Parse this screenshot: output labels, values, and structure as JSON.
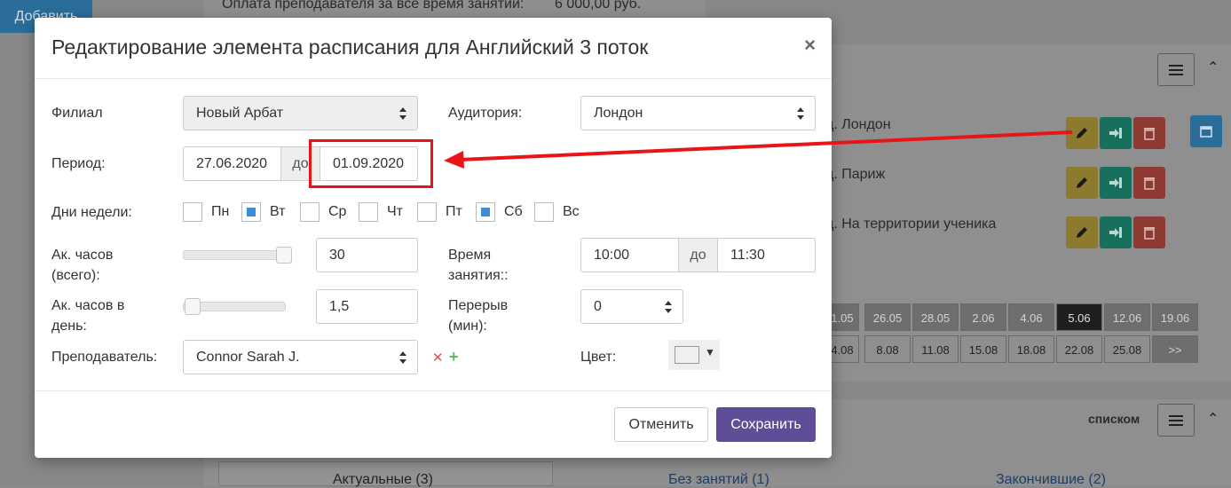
{
  "background": {
    "top_text_label": "Оплата преподавателя за всё время занятий:",
    "top_text_value": "6 000,00 руб.",
    "add_button": "Добавить",
    "rooms": [
      "д. Лондон",
      "д. Париж",
      "д. На территории ученика"
    ],
    "calendar_top": [
      "1.05",
      "26.05",
      "28.05",
      "2.06",
      "4.06",
      "5.06",
      "12.06",
      "19.06"
    ],
    "calendar_bottom": [
      "4.08",
      "8.08",
      "11.08",
      "15.08",
      "18.08",
      "22.08",
      "25.08",
      ">>"
    ],
    "list_label": "списком",
    "tabs": [
      "Актуальные (3)",
      "Без занятий (1)",
      "Закончившие (2)"
    ]
  },
  "modal": {
    "title": "Редактирование элемента расписания для Английский 3 поток",
    "close": "×",
    "branch_label": "Филиал",
    "branch_value": "Новый Арбат",
    "room_label": "Аудитория:",
    "room_value": "Лондон",
    "period_label": "Период:",
    "period_from": "27.06.2020",
    "period_sep": "до",
    "period_to": "01.09.2020",
    "weekdays_label": "Дни недели:",
    "weekdays": [
      {
        "label": "Пн",
        "checked": false
      },
      {
        "label": "Вт",
        "checked": true
      },
      {
        "label": "Ср",
        "checked": false
      },
      {
        "label": "Чт",
        "checked": false
      },
      {
        "label": "Пт",
        "checked": false
      },
      {
        "label": "Сб",
        "checked": true
      },
      {
        "label": "Вс",
        "checked": false
      }
    ],
    "hours_total_label_1": "Ак. часов",
    "hours_total_label_2": "(всего):",
    "hours_total_value": "30",
    "time_label_1": "Время",
    "time_label_2": "занятия::",
    "time_from": "10:00",
    "time_sep": "до",
    "time_to": "11:30",
    "hours_day_label_1": "Ак. часов в",
    "hours_day_label_2": "день:",
    "hours_day_value": "1,5",
    "break_label_1": "Перерыв",
    "break_label_2": "(мин):",
    "break_value": "0",
    "teacher_label": "Преподаватель:",
    "teacher_value": "Connor Sarah J.",
    "color_label": "Цвет:",
    "cancel": "Отменить",
    "save": "Сохранить"
  },
  "colors": {
    "primary": "#5f4d97",
    "checkbox": "#3a8fd6",
    "remove": "#d9534f",
    "add": "#5cb85c",
    "annotation": "#e8141a"
  }
}
